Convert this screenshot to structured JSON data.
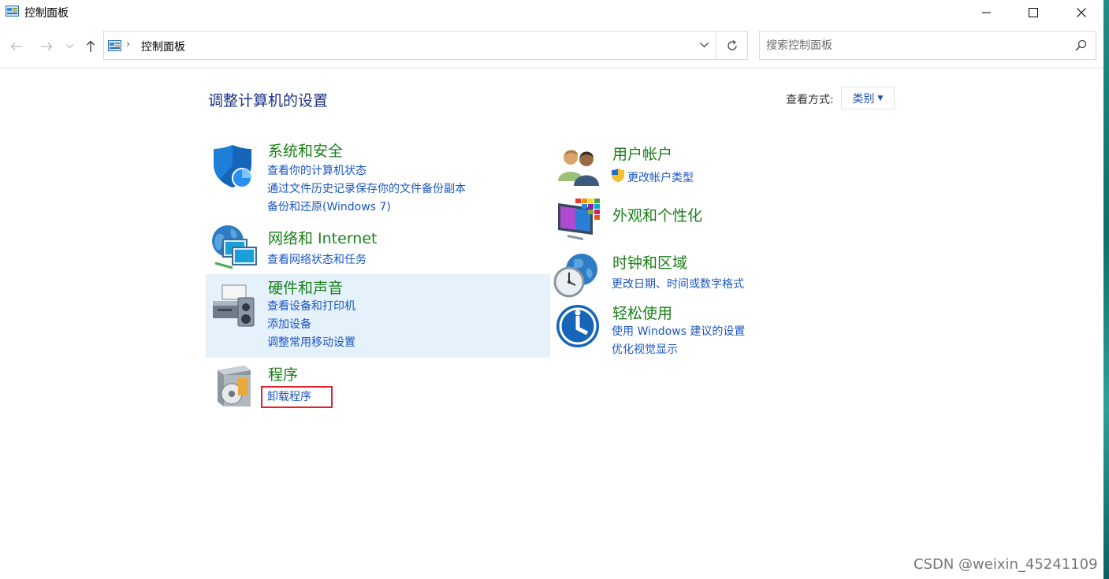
{
  "window": {
    "title": "控制面板",
    "minimize_icon": "minimize-icon",
    "maximize_icon": "maximize-icon",
    "close_icon": "close-icon"
  },
  "address": {
    "location": "控制面板",
    "separator": "›"
  },
  "search": {
    "placeholder": "搜索控制面板"
  },
  "main": {
    "heading": "调整计算机的设置",
    "view_by_label": "查看方式:",
    "view_by_value": "类别"
  },
  "categories": [
    {
      "title": "系统和安全",
      "icon": "shield-icon",
      "links": [
        "查看你的计算机状态",
        "通过文件历史记录保存你的文件备份副本",
        "备份和还原(Windows 7)"
      ]
    },
    {
      "title": "网络和 Internet",
      "icon": "network-globe-icon",
      "links": [
        "查看网络状态和任务"
      ]
    },
    {
      "title": "硬件和声音",
      "icon": "printer-speaker-icon",
      "links": [
        "查看设备和打印机",
        "添加设备",
        "调整常用移动设置"
      ]
    },
    {
      "title": "程序",
      "icon": "programs-disc-icon",
      "links": [
        "卸载程序"
      ]
    },
    {
      "title": "用户帐户",
      "icon": "user-accounts-icon",
      "links": [
        "更改帐户类型"
      ]
    },
    {
      "title": "外观和个性化",
      "icon": "appearance-monitor-icon",
      "links": []
    },
    {
      "title": "时钟和区域",
      "icon": "clock-globe-icon",
      "links": [
        "更改日期、时间或数字格式"
      ]
    },
    {
      "title": "轻松使用",
      "icon": "ease-of-access-icon",
      "links": [
        "使用 Windows 建议的设置",
        "优化视觉显示"
      ]
    }
  ],
  "highlighted_category": "硬件和声音",
  "watermark": "CSDN @weixin_45241109",
  "colors": {
    "category_title": "#1a7f1a",
    "link": "#1a56c2",
    "heading": "#1e3287",
    "highlight_bg": "#e5f1fb",
    "annotation_box": "#e8202a"
  }
}
